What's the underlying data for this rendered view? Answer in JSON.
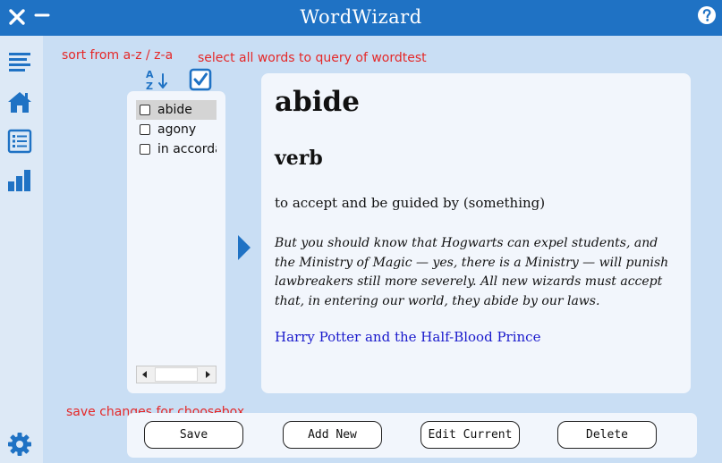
{
  "window": {
    "title": "WordWizard",
    "icons": {
      "close": "close-icon",
      "minimize": "minimize-icon",
      "help": "help-icon"
    },
    "accent_color": "#1f72c4"
  },
  "sidebar": {
    "items": [
      {
        "icon": "menu-icon"
      },
      {
        "icon": "home-icon"
      },
      {
        "icon": "list-icon"
      },
      {
        "icon": "bar-chart-icon"
      },
      {
        "icon": "gear-icon"
      }
    ]
  },
  "annotations": {
    "sort": "sort from a-z / z-a",
    "select_all": "select all words to query of wordtest",
    "save": "save changes for choosebox",
    "color": "#e52828"
  },
  "word_list": {
    "items": [
      {
        "label": "abide",
        "checked": false,
        "selected": true
      },
      {
        "label": "agony",
        "checked": false,
        "selected": false
      },
      {
        "label": "in accordance",
        "checked": false,
        "selected": false
      }
    ]
  },
  "detail": {
    "word": "abide",
    "part_of_speech": "verb",
    "definition": "to accept and be guided by (something)",
    "example": "But you should know that Hogwarts can expel students, and the Ministry of Magic — yes, there is a Ministry — will punish lawbreakers still more severely. All new wizards must accept that, in entering our world, they abide by our laws.",
    "source": "Harry Potter and the Half-Blood Prince",
    "source_color": "#1a1acc"
  },
  "toolbar": {
    "save_label": "Save",
    "add_label": "Add New",
    "edit_label": "Edit Current",
    "delete_label": "Delete"
  }
}
